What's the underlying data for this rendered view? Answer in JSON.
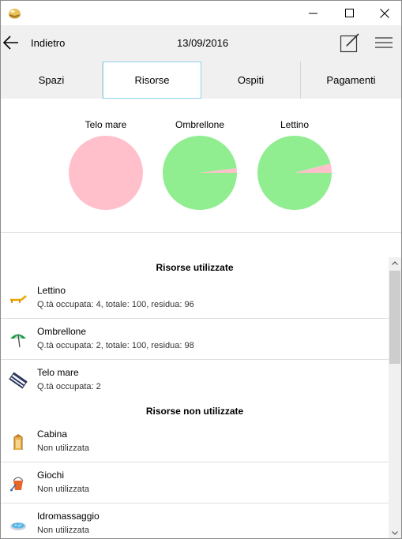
{
  "window": {
    "close_glyph": "✕",
    "maximize_glyph": "☐",
    "minimize_glyph": "—"
  },
  "header": {
    "back_label": "Indietro",
    "date": "13/09/2016"
  },
  "tabs": [
    {
      "label": "Spazi",
      "active": false
    },
    {
      "label": "Risorse",
      "active": true
    },
    {
      "label": "Ospiti",
      "active": false
    },
    {
      "label": "Pagamenti",
      "active": false
    }
  ],
  "charts": [
    {
      "label": "Telo mare",
      "used_fraction": 1.0,
      "used_color": "#ffc0cb",
      "free_color": "#90ee90"
    },
    {
      "label": "Ombrellone",
      "used_fraction": 0.02,
      "used_color": "#ffc0cb",
      "free_color": "#90ee90"
    },
    {
      "label": "Lettino",
      "used_fraction": 0.04,
      "used_color": "#ffc0cb",
      "free_color": "#90ee90"
    }
  ],
  "sections": {
    "used_title": "Risorse utilizzate",
    "unused_title": "Risorse non utilizzate"
  },
  "used_resources": [
    {
      "name": "Lettino",
      "detail": "Q.tà occupata: 4, totale: 100, residua: 96",
      "icon": "sunbed-icon"
    },
    {
      "name": "Ombrellone",
      "detail": "Q.tà occupata: 2, totale: 100, residua: 98",
      "icon": "umbrella-icon"
    },
    {
      "name": "Telo mare",
      "detail": "Q.tà occupata: 2",
      "icon": "towel-icon"
    }
  ],
  "unused_resources": [
    {
      "name": "Cabina",
      "detail": "Non utilizzata",
      "icon": "cabin-icon"
    },
    {
      "name": "Giochi",
      "detail": "Non utilizzata",
      "icon": "bucket-icon"
    },
    {
      "name": "Idromassaggio",
      "detail": "Non utilizzata",
      "icon": "jacuzzi-icon"
    }
  ]
}
